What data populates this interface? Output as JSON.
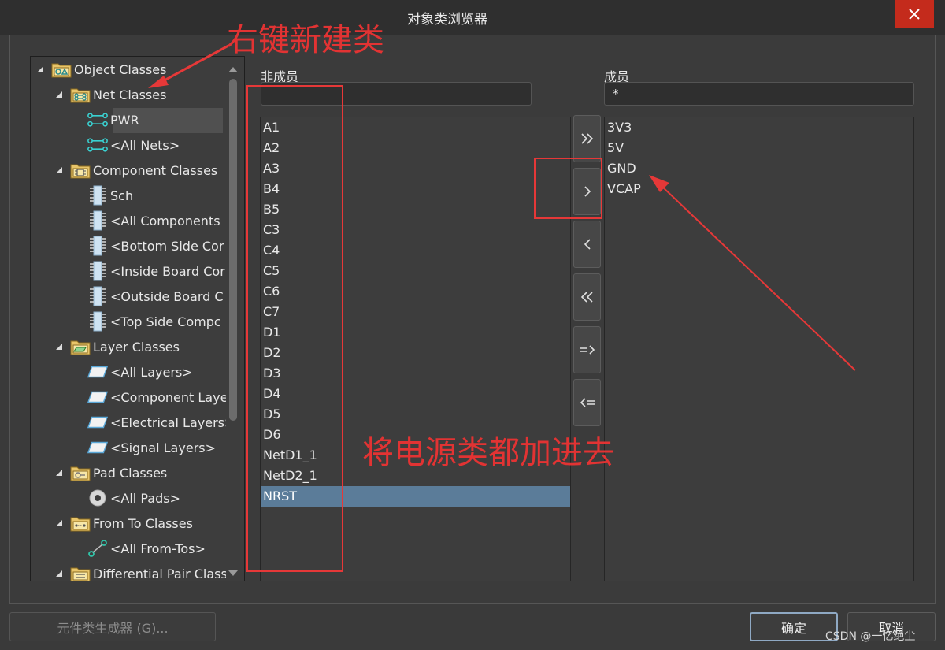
{
  "window": {
    "title": "对象类浏览器"
  },
  "tree": {
    "items": [
      {
        "label": "Object Classes",
        "icon": "folder-object-icon"
      },
      {
        "label": "Net Classes",
        "icon": "folder-net-icon"
      },
      {
        "label": "PWR",
        "icon": "net-icon"
      },
      {
        "label": "<All Nets>",
        "icon": "net-icon"
      },
      {
        "label": "Component Classes",
        "icon": "folder-component-icon"
      },
      {
        "label": "Sch",
        "icon": "component-icon"
      },
      {
        "label": "<All Components",
        "icon": "component-icon"
      },
      {
        "label": "<Bottom Side Cor",
        "icon": "component-icon"
      },
      {
        "label": "<Inside Board Cor",
        "icon": "component-icon"
      },
      {
        "label": "<Outside Board C",
        "icon": "component-icon"
      },
      {
        "label": "<Top Side Compc",
        "icon": "component-icon"
      },
      {
        "label": "Layer Classes",
        "icon": "folder-layer-icon"
      },
      {
        "label": "<All Layers>",
        "icon": "layer-icon"
      },
      {
        "label": "<Component Laye",
        "icon": "layer-icon"
      },
      {
        "label": "<Electrical Layers>",
        "icon": "layer-icon"
      },
      {
        "label": "<Signal Layers>",
        "icon": "layer-icon"
      },
      {
        "label": "Pad Classes",
        "icon": "folder-pad-icon"
      },
      {
        "label": "<All Pads>",
        "icon": "pad-icon"
      },
      {
        "label": "From To Classes",
        "icon": "folder-fromto-icon"
      },
      {
        "label": "<All From-Tos>",
        "icon": "fromto-icon"
      },
      {
        "label": "Differential Pair Class",
        "icon": "folder-diffpair-icon"
      }
    ],
    "selected": "PWR"
  },
  "non_members": {
    "label": "非成员",
    "filter": "",
    "items": [
      "A1",
      "A2",
      "A3",
      "B4",
      "B5",
      "C3",
      "C4",
      "C5",
      "C6",
      "C7",
      "D1",
      "D2",
      "D3",
      "D4",
      "D5",
      "D6",
      "NetD1_1",
      "NetD2_1",
      "NRST"
    ],
    "selected": "NRST"
  },
  "members": {
    "label": "成员",
    "filter": "*",
    "items": [
      "3V3",
      "5V",
      "GND",
      "VCAP"
    ]
  },
  "move_buttons": [
    {
      "name": "add-all-button",
      "icon": "double-chevron-right-icon"
    },
    {
      "name": "add-button",
      "icon": "chevron-right-icon"
    },
    {
      "name": "remove-button",
      "icon": "chevron-left-icon"
    },
    {
      "name": "remove-all-button",
      "icon": "double-chevron-left-icon"
    },
    {
      "name": "add-matching-button",
      "icon": "equals-arrow-right-icon"
    },
    {
      "name": "remove-matching-button",
      "icon": "equals-arrow-left-icon"
    }
  ],
  "footer": {
    "generator_label": "元件类生成器 (G)...",
    "ok_label": "确定",
    "cancel_label": "取消"
  },
  "annotations": {
    "new_class": "右键新建类",
    "add_power": "将电源类都加进去",
    "color": "#e63838"
  },
  "watermark": "CSDN @一忆绝尘"
}
